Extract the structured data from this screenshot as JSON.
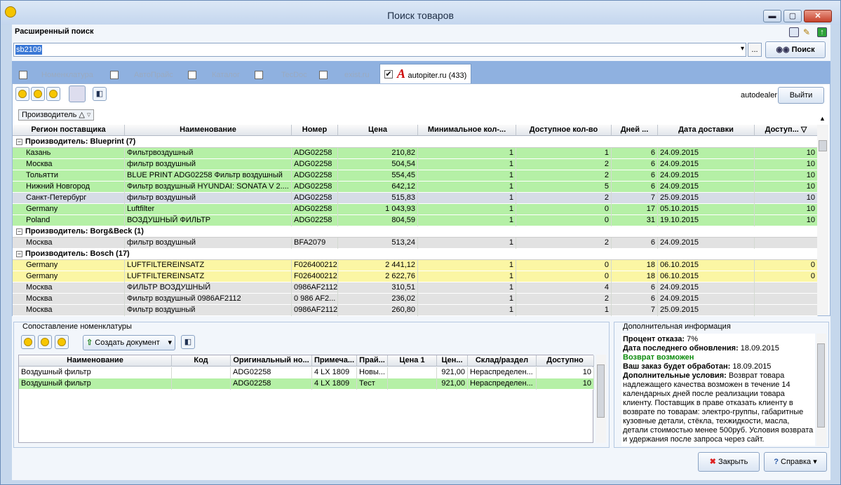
{
  "window": {
    "title": "Поиск товаров"
  },
  "adv_search": "Расширенный поиск",
  "search": {
    "value": "sb2109",
    "more": "...",
    "button": "Поиск"
  },
  "tabs": [
    {
      "label": "Номенклатура",
      "checked": false
    },
    {
      "label": "АвтоПрайс",
      "checked": false
    },
    {
      "label": "Каталог",
      "checked": false
    },
    {
      "label": "TecDoc",
      "checked": false
    },
    {
      "label": "exist.ru",
      "checked": false
    },
    {
      "label": "autopiter.ru (433)",
      "checked": true
    }
  ],
  "user": "autodealer",
  "logout": "Выйти",
  "group_by": "Производитель △",
  "columns": [
    "Регион поставщика",
    "Наименование",
    "Номер",
    "Цена",
    "Минимальное кол-...",
    "Доступное кол-во",
    "Дней ...",
    "Дата доставки",
    "Доступ... ▽"
  ],
  "groups": [
    {
      "label": "Производитель: Blueprint (7)",
      "rows": [
        {
          "region": "Казань",
          "name": "Фильтрвоздушный",
          "num": "ADG02258",
          "price": "210,82",
          "min": "1",
          "avail": "1",
          "days": "6",
          "date": "24.09.2015",
          "acc": "10",
          "color": "#b5f0a6"
        },
        {
          "region": "Москва",
          "name": "фильтр воздушный",
          "num": "ADG02258",
          "price": "504,54",
          "min": "1",
          "avail": "2",
          "days": "6",
          "date": "24.09.2015",
          "acc": "10",
          "color": "#b5f0a6"
        },
        {
          "region": "Тольятти",
          "name": "BLUE PRINT ADG02258 Фильтр воздушный",
          "num": "ADG02258",
          "price": "554,45",
          "min": "1",
          "avail": "2",
          "days": "6",
          "date": "24.09.2015",
          "acc": "10",
          "color": "#b5f0a6"
        },
        {
          "region": "Нижний Новгород",
          "name": "Фильтр воздушный HYUNDAI: SONATA V 2....",
          "num": "ADG02258",
          "price": "642,12",
          "min": "1",
          "avail": "5",
          "days": "6",
          "date": "24.09.2015",
          "acc": "10",
          "color": "#b5f0a6"
        },
        {
          "region": "Санкт-Петербург",
          "name": "фильтр воздушный",
          "num": "ADG02258",
          "price": "515,83",
          "min": "1",
          "avail": "2",
          "days": "7",
          "date": "25.09.2015",
          "acc": "10",
          "color": "#d6dce6"
        },
        {
          "region": "Germany",
          "name": "Luftfilter",
          "num": "ADG02258",
          "price": "1 043,93",
          "min": "1",
          "avail": "0",
          "days": "17",
          "date": "05.10.2015",
          "acc": "10",
          "color": "#b5f0a6"
        },
        {
          "region": "Poland",
          "name": "ВОЗДУШНЫЙ ФИЛЬТР",
          "num": "ADG02258",
          "price": "804,59",
          "min": "1",
          "avail": "0",
          "days": "31",
          "date": "19.10.2015",
          "acc": "10",
          "color": "#b5f0a6"
        }
      ]
    },
    {
      "label": "Производитель: Borg&Beck (1)",
      "rows": [
        {
          "region": "Москва",
          "name": "фильтр воздушный",
          "num": "BFA2079",
          "price": "513,24",
          "min": "1",
          "avail": "2",
          "days": "6",
          "date": "24.09.2015",
          "acc": "",
          "color": "#e2e2e2"
        }
      ]
    },
    {
      "label": "Производитель: Bosch (17)",
      "rows": [
        {
          "region": "Germany",
          "name": "LUFTFILTEREINSATZ",
          "num": "F026400212",
          "price": "2 441,12",
          "min": "1",
          "avail": "0",
          "days": "18",
          "date": "06.10.2015",
          "acc": "0",
          "color": "#fbf6a4"
        },
        {
          "region": "Germany",
          "name": "LUFTFILTEREINSATZ",
          "num": "F026400212",
          "price": "2 622,76",
          "min": "1",
          "avail": "0",
          "days": "18",
          "date": "06.10.2015",
          "acc": "0",
          "color": "#fbf6a4"
        },
        {
          "region": "Москва",
          "name": "ФИЛЬТР ВОЗДУШНЫЙ",
          "num": "0986AF2112",
          "price": "310,51",
          "min": "1",
          "avail": "4",
          "days": "6",
          "date": "24.09.2015",
          "acc": "",
          "color": "#e2e2e2"
        },
        {
          "region": "Москва",
          "name": "Фильтр воздушный 0986AF2112",
          "num": "0 986 AF2...",
          "price": "236,02",
          "min": "1",
          "avail": "2",
          "days": "6",
          "date": "24.09.2015",
          "acc": "",
          "color": "#e2e2e2"
        },
        {
          "region": "Москва",
          "name": "Фильтр воздушный",
          "num": "0986AF2112",
          "price": "260,80",
          "min": "1",
          "avail": "1",
          "days": "7",
          "date": "25.09.2015",
          "acc": "",
          "color": "#e2e2e2"
        }
      ]
    }
  ],
  "match": {
    "title": "Сопоставление номенклатуры",
    "create_doc": "Создать документ",
    "columns": [
      "Наименование",
      "Код",
      "Оригинальный но...",
      "Примеча...",
      "Прай...",
      "Цена 1",
      "Цен...",
      "Склад/раздел",
      "Доступно"
    ],
    "rows": [
      {
        "name": "Воздушный фильтр",
        "code": "",
        "orig": "ADG02258",
        "note": "4 LX 1809",
        "price_list": "Новы...",
        "p1": "",
        "p2": "921,00",
        "store": "Нераспределен...",
        "avail": "10",
        "color": "#ffffff"
      },
      {
        "name": "Воздушный фильтр",
        "code": "",
        "orig": "ADG02258",
        "note": "4 LX 1809",
        "price_list": "Тест",
        "p1": "",
        "p2": "921,00",
        "store": "Нераспределен...",
        "avail": "10",
        "color": "#b5f0a6"
      }
    ]
  },
  "info": {
    "title": "Дополнительная информация",
    "refusal_label": "Процент отказа:",
    "refusal": "7%",
    "updated_label": "Дата последнего обновления:",
    "updated": "18.09.2015",
    "return": "Возврат возможен",
    "processed_label": "Ваш заказ будет обработан:",
    "processed": "18.09.2015",
    "terms_label": "Дополнительные условия:",
    "terms": "Возврат товара надлежащего качества возможен в течение 14 календарных дней после реализации товара клиенту. Поставщик в праве отказать клиенту в возврате по товарам: электро-группы, габаритные кузовные детали, стёкла, техжидкости, масла, детали стоимостью менее 500руб. Условия возврата и удержания после запроса через сайт."
  },
  "footer": {
    "close": "Закрыть",
    "help": "Справка"
  }
}
